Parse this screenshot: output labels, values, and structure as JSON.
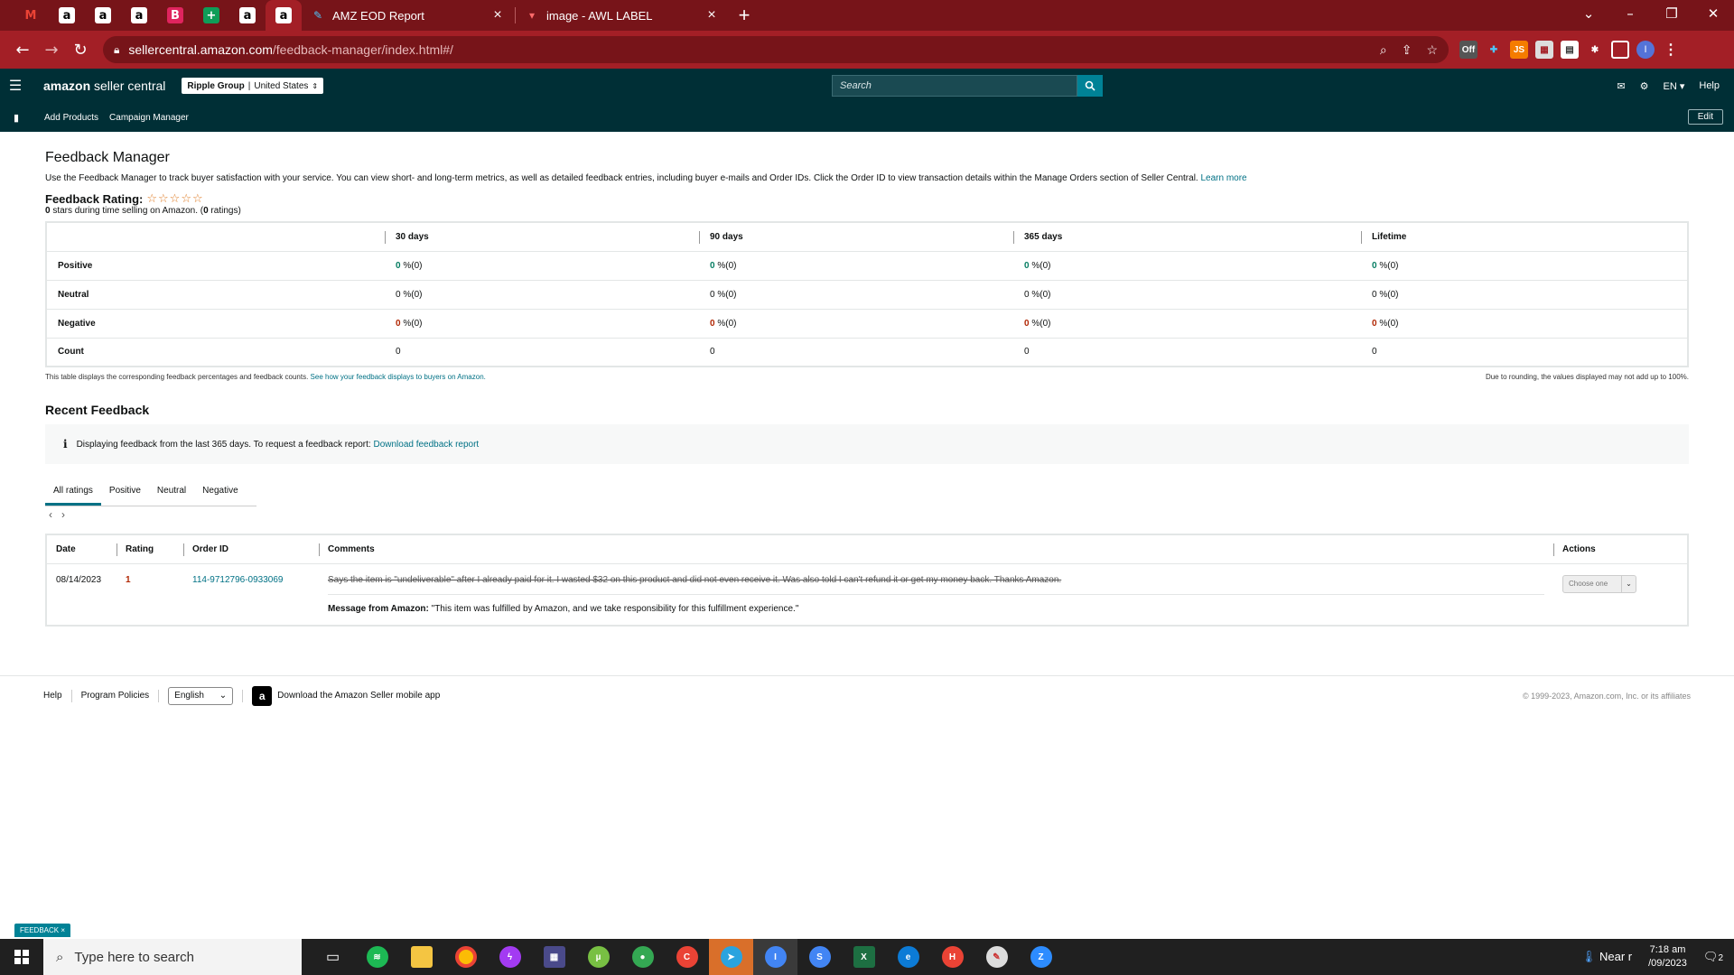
{
  "browser": {
    "pinned_tabs": [
      {
        "icon": "gmail-icon",
        "glyph": "M",
        "bg": "#771419",
        "fg": "#ea4335"
      },
      {
        "icon": "amazon-icon",
        "glyph": "a",
        "bg": "#000000",
        "fg": "#ffffff"
      },
      {
        "icon": "amazon-icon",
        "glyph": "a",
        "bg": "#000000",
        "fg": "#ffffff"
      },
      {
        "icon": "amazon-icon",
        "glyph": "a",
        "bg": "#000000",
        "fg": "#ffffff"
      },
      {
        "icon": "brand-b-icon",
        "glyph": "B",
        "bg": "#e0245e",
        "fg": "#ffffff"
      },
      {
        "icon": "sheets-icon",
        "glyph": "+",
        "bg": "#0f9d58",
        "fg": "#ffffff"
      },
      {
        "icon": "amazon-icon",
        "glyph": "a",
        "bg": "#000000",
        "fg": "#ffffff"
      },
      {
        "icon": "amazon-icon",
        "glyph": "a",
        "bg": "#000000",
        "fg": "#ffffff"
      }
    ],
    "tabs": [
      {
        "title": "AMZ EOD Report",
        "icon": "pencil-icon"
      },
      {
        "title": "image - AWL LABEL",
        "icon": "image-icon"
      }
    ],
    "url_host": "sellercentral.amazon.com",
    "url_path": "/feedback-manager/index.html#/"
  },
  "header": {
    "logo_brand": "amazon",
    "logo_suffix": " seller central",
    "account_name": "Ripple Group",
    "account_region": "United States",
    "search_placeholder": "Search",
    "language": "EN",
    "help": "Help"
  },
  "subnav": {
    "items": [
      "Add Products",
      "Campaign Manager"
    ],
    "edit": "Edit"
  },
  "page": {
    "title": "Feedback Manager",
    "intro": "Use the Feedback Manager to track buyer satisfaction with your service. You can view short- and long-term metrics, as well as detailed feedback entries, including buyer e-mails and Order IDs. Click the Order ID to view transaction details within the Manage Orders section of Seller Central.",
    "learn_more": "Learn more",
    "rating_label": "Feedback Rating:",
    "rating_stars": "☆☆☆☆☆",
    "stars_value": "0",
    "stars_text": " stars during time selling on Amazon. (",
    "ratings_count": "0",
    "ratings_suffix": " ratings)"
  },
  "metrics": {
    "columns": [
      "30 days",
      "90 days",
      "365 days",
      "Lifetime"
    ],
    "rows": [
      {
        "label": "Positive",
        "values": [
          "0",
          "0",
          "0",
          "0"
        ],
        "suffix": " %(0)",
        "tone": "g"
      },
      {
        "label": "Neutral",
        "values": [
          "0",
          "0",
          "0",
          "0"
        ],
        "suffix": " %(0)",
        "tone": ""
      },
      {
        "label": "Negative",
        "values": [
          "0",
          "0",
          "0",
          "0"
        ],
        "suffix": " %(0)",
        "tone": "r"
      },
      {
        "label": "Count",
        "values": [
          "0",
          "0",
          "0",
          "0"
        ],
        "suffix": "",
        "tone": "plain"
      }
    ],
    "note_left": "This table displays the corresponding feedback percentages and feedback counts.",
    "note_link": "See how your feedback displays to buyers on Amazon.",
    "note_right": "Due to rounding, the values displayed may not add up to 100%."
  },
  "recent": {
    "title": "Recent Feedback",
    "info_text": "Displaying feedback from the last 365 days. To request a feedback report:",
    "info_link": "Download feedback report",
    "filter_tabs": [
      "All ratings",
      "Positive",
      "Neutral",
      "Negative"
    ],
    "columns": {
      "date": "Date",
      "rating": "Rating",
      "order": "Order ID",
      "comments": "Comments",
      "actions": "Actions"
    },
    "entries": [
      {
        "date": "08/14/2023",
        "rating": "1",
        "order_id": "114-9712796-0933069",
        "comment": "Says the item is \"undeliverable\" after I already paid for it. I wasted $32 on this product and did not even receive it. Was also told I can't refund it or get my money back. Thanks Amazon.",
        "message_label": "Message from Amazon:",
        "message": " \"This item was fulfilled by Amazon, and we take responsibility for this fulfillment experience.\"",
        "action": "Choose one"
      }
    ]
  },
  "footer": {
    "help": "Help",
    "policies": "Program Policies",
    "language": "English",
    "app_text": "Download the Amazon Seller mobile app",
    "copyright": "© 1999-2023, Amazon.com, Inc. or its affiliates"
  },
  "feedback_tab": "FEEDBACK ×",
  "taskbar": {
    "search_placeholder": "Type here to search",
    "weather": "Near r",
    "time": "7:18 am",
    "date": "/09/2023",
    "notifications": "2"
  }
}
